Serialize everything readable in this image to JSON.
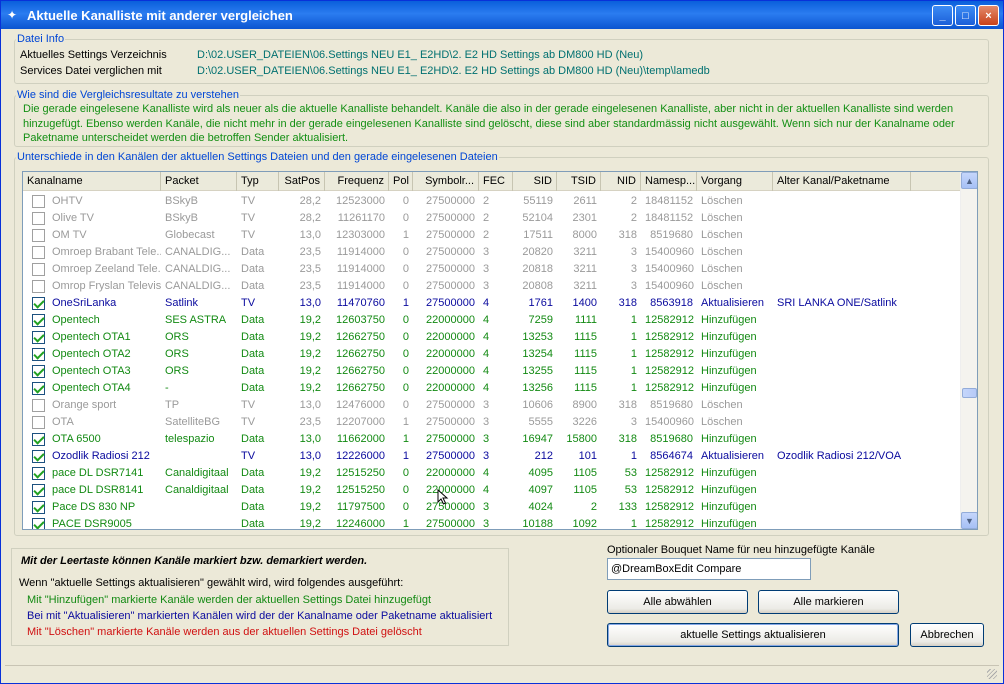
{
  "window": {
    "title": "Aktuelle Kanalliste mit anderer vergleichen",
    "min": "_",
    "max": "□",
    "close": "×"
  },
  "fileinfo": {
    "legend": "Datei Info",
    "settings_label": "Aktuelles Settings Verzeichnis",
    "settings_value": "D:\\02.USER_DATEIEN\\06.Settings NEU  E1_ E2HD\\2. E2 HD Settings ab DM800 HD  (Neu)",
    "services_label": "Services Datei verglichen mit",
    "services_value": "D:\\02.USER_DATEIEN\\06.Settings NEU  E1_ E2HD\\2. E2 HD Settings ab DM800 HD  (Neu)\\temp\\lamedb"
  },
  "explain": {
    "legend": "Wie sind die Vergleichsresultate zu verstehen",
    "text": "Die gerade eingelesene Kanalliste wird als neuer als die aktuelle Kanalliste behandelt. Kanäle die also in der gerade eingelesenen Kanalliste, aber nicht in der aktuellen Kanalliste sind werden hinzugefügt. Ebenso werden Kanäle, die nicht mehr in der gerade eingelesenen Kanalliste sind gelöscht, diese sind aber standardmässig nicht ausgewählt. Wenn sich nur der Kanalname oder Paketname unterscheidet werden die betroffen Sender aktualisiert."
  },
  "diff": {
    "legend": "Unterschiede in den Kanälen der aktuellen Settings Dateien und den gerade eingelesenen Dateien",
    "columns": [
      "Kanalname",
      "Packet",
      "Typ",
      "SatPos",
      "Frequenz",
      "Pol",
      "Symbolr...",
      "FEC",
      "SID",
      "TSID",
      "NID",
      "Namesp...",
      "Vorgang",
      "Alter Kanal/Paketname"
    ],
    "rows": [
      {
        "checked": false,
        "state": "L",
        "cells": [
          "OHTV",
          "BSkyB",
          "TV",
          "28,2",
          "12523000",
          "0",
          "27500000",
          "2",
          "55119",
          "2611",
          "2",
          "18481152",
          "Löschen",
          ""
        ]
      },
      {
        "checked": false,
        "state": "L",
        "cells": [
          "Olive TV",
          "BSkyB",
          "TV",
          "28,2",
          "11261170",
          "0",
          "27500000",
          "2",
          "52104",
          "2301",
          "2",
          "18481152",
          "Löschen",
          ""
        ]
      },
      {
        "checked": false,
        "state": "L",
        "cells": [
          "OM TV",
          "Globecast",
          "TV",
          "13,0",
          "12303000",
          "1",
          "27500000",
          "2",
          "17511",
          "8000",
          "318",
          "8519680",
          "Löschen",
          ""
        ]
      },
      {
        "checked": false,
        "state": "L",
        "cells": [
          "Omroep Brabant Tele...",
          "CANALDIG...",
          "Data",
          "23,5",
          "11914000",
          "0",
          "27500000",
          "3",
          "20820",
          "3211",
          "3",
          "15400960",
          "Löschen",
          ""
        ]
      },
      {
        "checked": false,
        "state": "L",
        "cells": [
          "Omroep Zeeland Tele...",
          "CANALDIG...",
          "Data",
          "23,5",
          "11914000",
          "0",
          "27500000",
          "3",
          "20818",
          "3211",
          "3",
          "15400960",
          "Löschen",
          ""
        ]
      },
      {
        "checked": false,
        "state": "L",
        "cells": [
          "Omrop Fryslan Televisie",
          "CANALDIG...",
          "Data",
          "23,5",
          "11914000",
          "0",
          "27500000",
          "3",
          "20808",
          "3211",
          "3",
          "15400960",
          "Löschen",
          ""
        ]
      },
      {
        "checked": true,
        "state": "A",
        "cells": [
          "OneSriLanka",
          "Satlink",
          "TV",
          "13,0",
          "11470760",
          "1",
          "27500000",
          "4",
          "1761",
          "1400",
          "318",
          "8563918",
          "Aktualisieren",
          "SRI LANKA ONE/Satlink"
        ]
      },
      {
        "checked": true,
        "state": "H",
        "cells": [
          "Opentech",
          "SES ASTRA",
          "Data",
          "19,2",
          "12603750",
          "0",
          "22000000",
          "4",
          "7259",
          "1111",
          "1",
          "12582912",
          "Hinzufügen",
          ""
        ]
      },
      {
        "checked": true,
        "state": "H",
        "cells": [
          "Opentech OTA1",
          "ORS",
          "Data",
          "19,2",
          "12662750",
          "0",
          "22000000",
          "4",
          "13253",
          "1115",
          "1",
          "12582912",
          "Hinzufügen",
          ""
        ]
      },
      {
        "checked": true,
        "state": "H",
        "cells": [
          "Opentech OTA2",
          "ORS",
          "Data",
          "19,2",
          "12662750",
          "0",
          "22000000",
          "4",
          "13254",
          "1115",
          "1",
          "12582912",
          "Hinzufügen",
          ""
        ]
      },
      {
        "checked": true,
        "state": "H",
        "cells": [
          "Opentech OTA3",
          "ORS",
          "Data",
          "19,2",
          "12662750",
          "0",
          "22000000",
          "4",
          "13255",
          "1115",
          "1",
          "12582912",
          "Hinzufügen",
          ""
        ]
      },
      {
        "checked": true,
        "state": "H",
        "cells": [
          "Opentech OTA4",
          "-",
          "Data",
          "19,2",
          "12662750",
          "0",
          "22000000",
          "4",
          "13256",
          "1115",
          "1",
          "12582912",
          "Hinzufügen",
          ""
        ]
      },
      {
        "checked": false,
        "state": "L",
        "cells": [
          "Orange sport",
          "TP",
          "TV",
          "13,0",
          "12476000",
          "0",
          "27500000",
          "3",
          "10606",
          "8900",
          "318",
          "8519680",
          "Löschen",
          ""
        ]
      },
      {
        "checked": false,
        "state": "L",
        "cells": [
          "OTA",
          "SatelliteBG",
          "TV",
          "23,5",
          "12207000",
          "1",
          "27500000",
          "3",
          "5555",
          "3226",
          "3",
          "15400960",
          "Löschen",
          ""
        ]
      },
      {
        "checked": true,
        "state": "H",
        "cells": [
          "OTA 6500",
          "telespazio",
          "Data",
          "13,0",
          "11662000",
          "1",
          "27500000",
          "3",
          "16947",
          "15800",
          "318",
          "8519680",
          "Hinzufügen",
          ""
        ]
      },
      {
        "checked": true,
        "state": "A",
        "cells": [
          "Ozodlik Radiosi 212",
          "",
          "TV",
          "13,0",
          "12226000",
          "1",
          "27500000",
          "3",
          "212",
          "101",
          "1",
          "8564674",
          "Aktualisieren",
          "Ozodlik Radiosi 212/VOA"
        ]
      },
      {
        "checked": true,
        "state": "H",
        "cells": [
          "pace DL DSR7141",
          "Canaldigitaal",
          "Data",
          "19,2",
          "12515250",
          "0",
          "22000000",
          "4",
          "4095",
          "1105",
          "53",
          "12582912",
          "Hinzufügen",
          ""
        ]
      },
      {
        "checked": true,
        "state": "H",
        "cells": [
          "pace DL DSR8141",
          "Canaldigitaal",
          "Data",
          "19,2",
          "12515250",
          "0",
          "22000000",
          "4",
          "4097",
          "1105",
          "53",
          "12582912",
          "Hinzufügen",
          ""
        ]
      },
      {
        "checked": true,
        "state": "H",
        "cells": [
          "Pace DS 830 NP",
          "",
          "Data",
          "19,2",
          "11797500",
          "0",
          "27500000",
          "3",
          "4024",
          "2",
          "133",
          "12582912",
          "Hinzufügen",
          ""
        ]
      },
      {
        "checked": true,
        "state": "H",
        "cells": [
          "PACE DSR9005",
          "",
          "Data",
          "19,2",
          "12246000",
          "1",
          "27500000",
          "3",
          "10188",
          "1092",
          "1",
          "12582912",
          "Hinzufügen",
          ""
        ]
      }
    ]
  },
  "info": {
    "hint": "Mit der Leertaste können Kanäle markiert bzw. demarkiert werden.",
    "intro": "Wenn \"aktuelle Settings aktualisieren\" gewählt wird, wird folgendes ausgeführt:",
    "add": "Mit \"Hinzufügen\" markierte Kanäle werden der aktuellen Settings Datei hinzugefügt",
    "update": "Bei mit \"Aktualisieren\" markierten Kanälen wird der der Kanalname oder Paketname aktualisiert",
    "delete": "Mit \"Löschen\" markierte Kanäle werden aus der aktuellen Settings Datei gelöscht"
  },
  "bouquet": {
    "label": "Optionaler Bouquet Name für neu hinzugefügte Kanäle",
    "value": "@DreamBoxEdit Compare"
  },
  "buttons": {
    "deselect_all": "Alle abwählen",
    "select_all": "Alle markieren",
    "update": "aktuelle Settings aktualisieren",
    "cancel": "Abbrechen"
  },
  "colors": {
    "add": "#138a13",
    "update": "#0a0a9e",
    "delete": "#d01010",
    "folder": "#007070",
    "legend": "#0046d5"
  }
}
